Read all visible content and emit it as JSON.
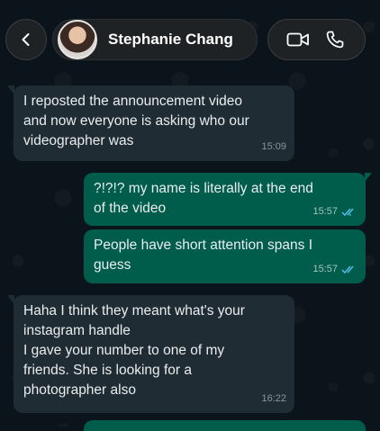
{
  "contact": {
    "name": "Stephanie Chang"
  },
  "icons": {
    "back": "chevron-left-icon",
    "video": "video-camera-icon",
    "call": "phone-icon",
    "read": "double-check-icon"
  },
  "colors": {
    "background": "#0b141a",
    "incoming": "#202c33",
    "outgoing": "#005c4b",
    "read_tick": "#53bdeb"
  },
  "messages": [
    {
      "direction": "in",
      "text": "I reposted the announcement video\nand now everyone is asking who our\nvideographer was",
      "time": "15:09"
    },
    {
      "direction": "out",
      "text": "?!?!? my name is literally at the end\nof the video",
      "time": "15:57",
      "status": "read"
    },
    {
      "direction": "out",
      "text": "People have short attention spans I\nguess",
      "time": "15:57",
      "status": "read"
    },
    {
      "direction": "in",
      "text": "Haha I think they meant what's your\ninstagram handle\nI gave your number to one of my\nfriends. She is looking for a\nphotographer also",
      "time": "16:22"
    }
  ]
}
